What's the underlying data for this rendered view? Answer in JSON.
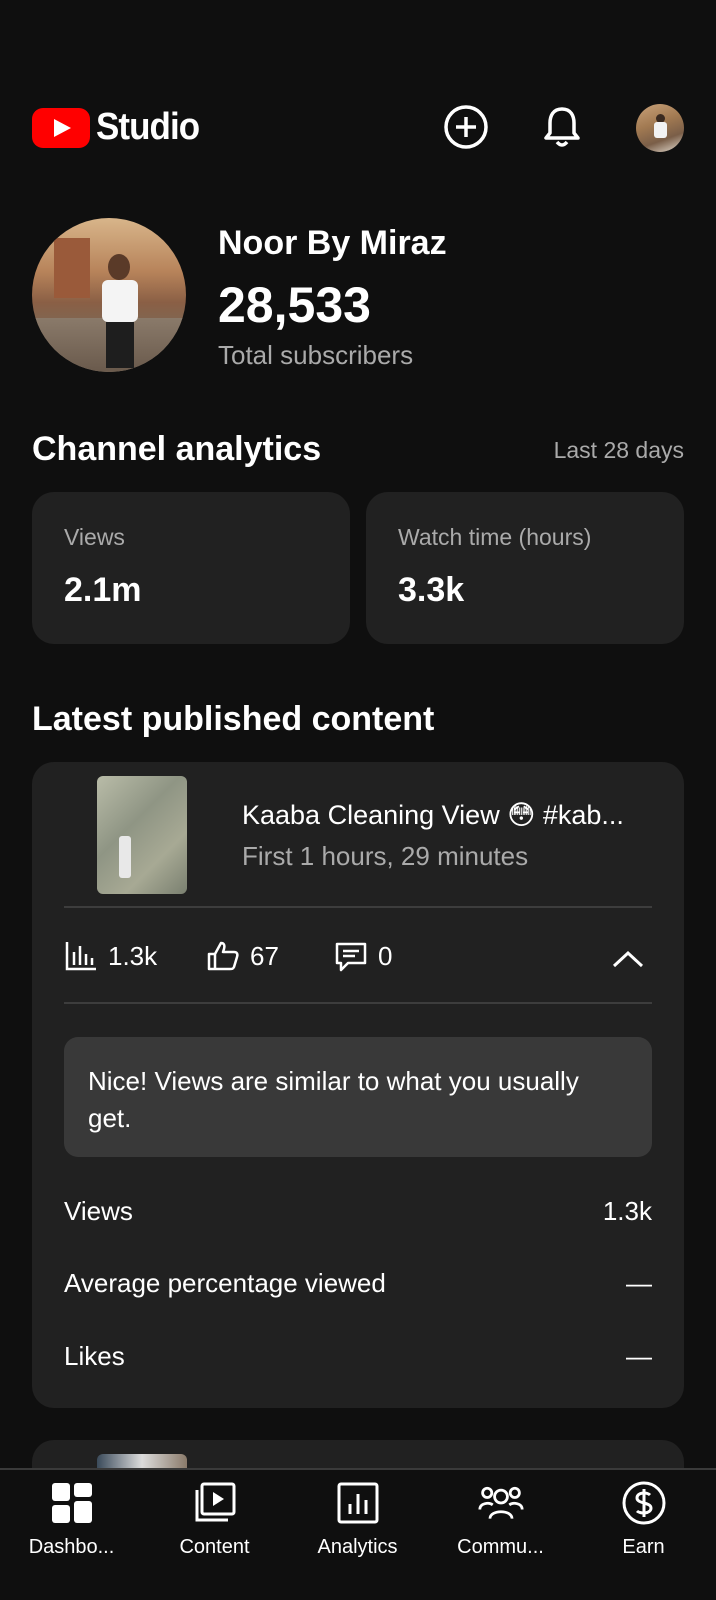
{
  "app": {
    "title": "Studio"
  },
  "channel": {
    "name": "Noor By Miraz",
    "subscribers": "28,533",
    "subscribers_label": "Total subscribers"
  },
  "analytics": {
    "title": "Channel analytics",
    "period": "Last 28 days",
    "cards": [
      {
        "label": "Views",
        "value": "2.1m"
      },
      {
        "label": "Watch time (hours)",
        "value": "3.3k"
      }
    ]
  },
  "latest": {
    "title": "Latest published content",
    "video": {
      "title": "Kaaba Cleaning View 😳 #kab...",
      "subtitle": "First 1 hours, 29 minutes",
      "views": "1.3k",
      "likes": "67",
      "comments": "0",
      "insight": "Nice! Views are similar to what you usually get.",
      "rows": [
        {
          "label": "Views",
          "value": "1.3k"
        },
        {
          "label": "Average percentage viewed",
          "value": "—"
        },
        {
          "label": "Likes",
          "value": "—"
        }
      ]
    }
  },
  "nav": [
    {
      "label": "Dashbo...",
      "icon": "dashboard-icon"
    },
    {
      "label": "Content",
      "icon": "content-icon"
    },
    {
      "label": "Analytics",
      "icon": "analytics-icon"
    },
    {
      "label": "Commu...",
      "icon": "community-icon"
    },
    {
      "label": "Earn",
      "icon": "earn-icon"
    }
  ],
  "colors": {
    "background": "#0f0f0f",
    "card": "#212121",
    "brand": "#ff0000",
    "muted": "#aaaaaa"
  }
}
